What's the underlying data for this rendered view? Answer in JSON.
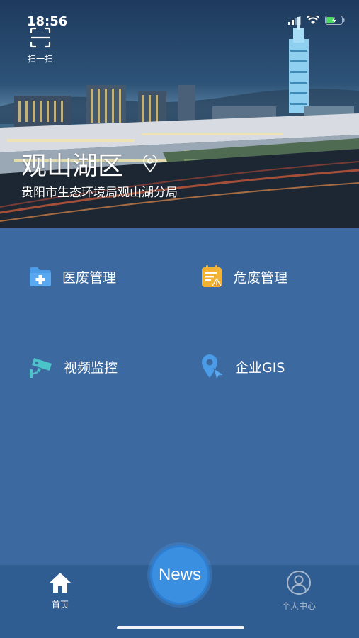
{
  "status_bar": {
    "time": "18:56",
    "icons": [
      "signal-icon",
      "wifi-icon",
      "battery-charging-icon"
    ]
  },
  "header": {
    "scan_label": "扫一扫",
    "scan_icon": "scan-icon",
    "region_title": "观山湖区",
    "location_icon": "location-pin-icon",
    "region_subtitle": "贵阳市生态环境局观山湖分局"
  },
  "menu": [
    {
      "label": "医废管理",
      "icon": "medical-folder-icon",
      "color": "#4a9be8"
    },
    {
      "label": "危废管理",
      "icon": "hazard-clipboard-icon",
      "color": "#f2b233"
    },
    {
      "label": "视频监控",
      "icon": "cctv-camera-icon",
      "color": "#4cc3c9"
    },
    {
      "label": "企业GIS",
      "icon": "map-pin-cursor-icon",
      "color": "#4a9be8"
    }
  ],
  "tabbar": {
    "home_label": "首页",
    "home_icon": "home-icon",
    "news_label": "News",
    "profile_label": "个人中心",
    "profile_icon": "user-circle-icon"
  },
  "colors": {
    "background": "#3c6aa0",
    "tabbar": "#2f5c91",
    "news_button": "#3a8fe0"
  }
}
